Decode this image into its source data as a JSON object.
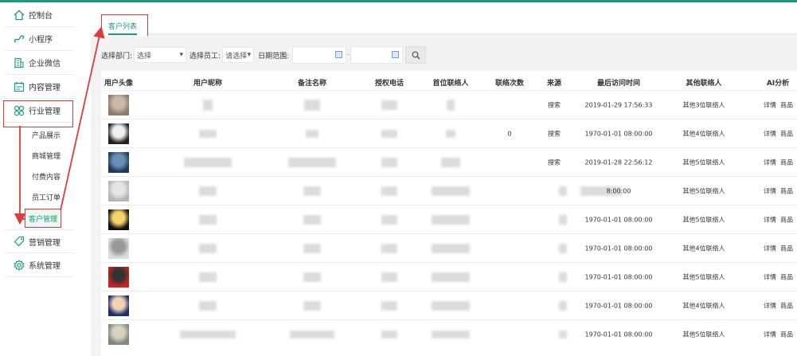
{
  "sidebar": {
    "items": [
      {
        "label": "控制台",
        "icon": "home-icon"
      },
      {
        "label": "小程序",
        "icon": "miniprogram-icon"
      },
      {
        "label": "企业微信",
        "icon": "building-icon"
      },
      {
        "label": "内容管理",
        "icon": "calendar-icon"
      },
      {
        "label": "行业管理",
        "icon": "grid-icon"
      }
    ],
    "sub_items": [
      "产品展示",
      "商城管理",
      "付费内容",
      "员工订单",
      "客户管理"
    ],
    "bottom_items": [
      {
        "label": "营销管理",
        "icon": "tag-icon"
      },
      {
        "label": "系统管理",
        "icon": "gear-icon"
      }
    ]
  },
  "tab": {
    "label": "客户列表"
  },
  "filters": {
    "dept_label": "选择部门:",
    "dept_value": "选择",
    "staff_label": "选择员工:",
    "staff_value": "请选择",
    "date_label": "日期范围:",
    "date_sep": "-"
  },
  "table": {
    "headers": [
      "用户头像",
      "用户昵称",
      "备注名称",
      "授权电话",
      "首位联络人",
      "联络次数",
      "来源",
      "最后访问时间",
      "其他联络人",
      "AI分析"
    ],
    "rows": [
      {
        "avatar": "avatar-1",
        "count": "",
        "source": "搜索",
        "time": "2019-01-29 17:56:33",
        "others": "其他3位联络人",
        "a1": "详情",
        "a2": "商品"
      },
      {
        "avatar": "avatar-2",
        "count": "0",
        "source": "搜索",
        "time": "1970-01-01 08:00:00",
        "others": "其他4位联络人",
        "a1": "详情",
        "a2": "商品"
      },
      {
        "avatar": "avatar-3",
        "count": "",
        "source": "搜索",
        "time": "2019-01-28 22:56:12",
        "others": "其他5位联络人",
        "a1": "详情",
        "a2": "商品"
      },
      {
        "avatar": "avatar-4",
        "count": "",
        "source": "",
        "time": "8:00:00",
        "others": "其他5位联络人",
        "a1": "详情",
        "a2": "商品"
      },
      {
        "avatar": "avatar-5",
        "count": "",
        "source": "",
        "time": "1970-01-01 08:00:00",
        "others": "其他5位联络人",
        "a1": "详情",
        "a2": "商品"
      },
      {
        "avatar": "avatar-6",
        "count": "",
        "source": "",
        "time": "1970-01-01 08:00:00",
        "others": "其他4位联络人",
        "a1": "详情",
        "a2": "商品"
      },
      {
        "avatar": "avatar-7",
        "count": "",
        "source": "",
        "time": "1970-01-01 08:00:00",
        "others": "其他5位联络人",
        "a1": "详情",
        "a2": "商品"
      },
      {
        "avatar": "avatar-8",
        "count": "",
        "source": "",
        "time": "1970-01-01 08:00:00",
        "others": "其他4位联络人",
        "a1": "详情",
        "a2": "商品"
      },
      {
        "avatar": "avatar-9",
        "count": "",
        "source": "",
        "time": "1970-01-01 08:00:00",
        "others": "其他5位联络人",
        "a1": "详情",
        "a2": "商品"
      }
    ]
  },
  "colors": {
    "accent": "#1b9b77",
    "annotation": "#e03a3a"
  }
}
